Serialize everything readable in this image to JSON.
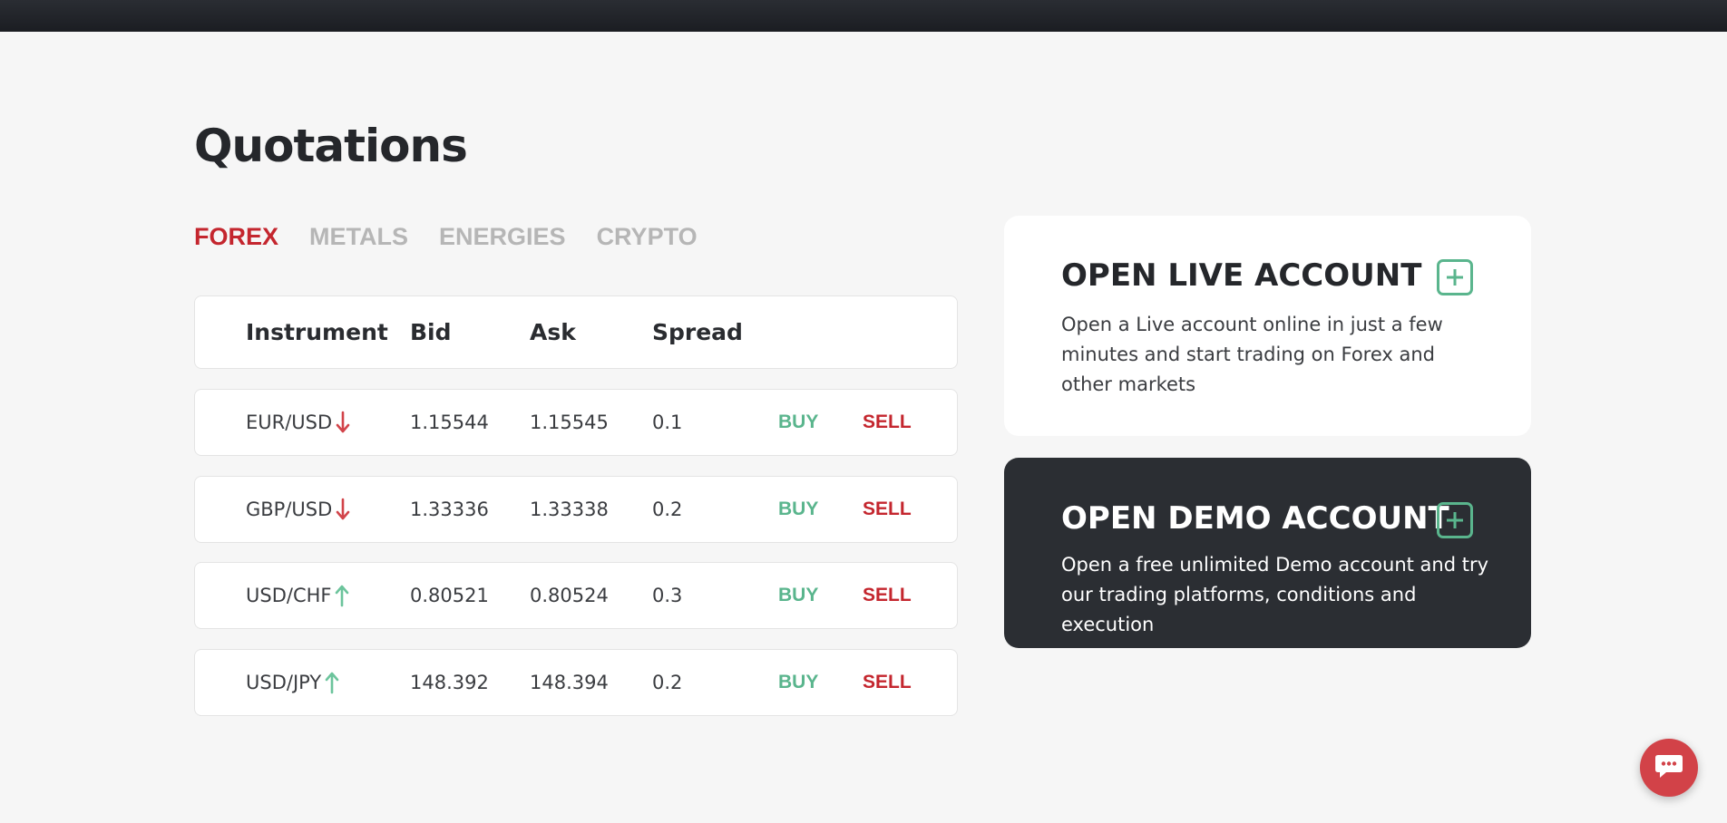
{
  "page": {
    "title": "Quotations"
  },
  "tabs": [
    {
      "label": "FOREX",
      "active": true
    },
    {
      "label": "METALS",
      "active": false
    },
    {
      "label": "ENERGIES",
      "active": false
    },
    {
      "label": "CRYPTO",
      "active": false
    }
  ],
  "table": {
    "headers": {
      "instrument": "Instrument",
      "bid": "Bid",
      "ask": "Ask",
      "spread": "Spread"
    },
    "rows": [
      {
        "instrument": "EUR/USD",
        "direction": "down",
        "bid": "1.15544",
        "ask": "1.15545",
        "spread": "0.1",
        "buy": "BUY",
        "sell": "SELL"
      },
      {
        "instrument": "GBP/USD",
        "direction": "down",
        "bid": "1.33336",
        "ask": "1.33338",
        "spread": "0.2",
        "buy": "BUY",
        "sell": "SELL"
      },
      {
        "instrument": "USD/CHF",
        "direction": "up",
        "bid": "0.80521",
        "ask": "0.80524",
        "spread": "0.3",
        "buy": "BUY",
        "sell": "SELL"
      },
      {
        "instrument": "USD/JPY",
        "direction": "up",
        "bid": "148.392",
        "ask": "148.394",
        "spread": "0.2",
        "buy": "BUY",
        "sell": "SELL"
      }
    ]
  },
  "cards": {
    "live": {
      "title": "OPEN LIVE ACCOUNT",
      "text": "Open a Live account online in just a few minutes and start trading on Forex and other markets"
    },
    "demo": {
      "title": "OPEN DEMO ACCOUNT",
      "text": "Open a free unlimited Demo account and try our trading platforms, conditions and execution"
    }
  },
  "icons": {
    "arrow_down": "arrow-down-icon",
    "arrow_up": "arrow-up-icon",
    "plus": "plus-square-icon",
    "chat": "chat-bubble-icon"
  },
  "colors": {
    "accent_red": "#c4262e",
    "accent_green": "#5ab58d",
    "dark_card": "#2b2e33",
    "chat_button": "#d24248"
  }
}
